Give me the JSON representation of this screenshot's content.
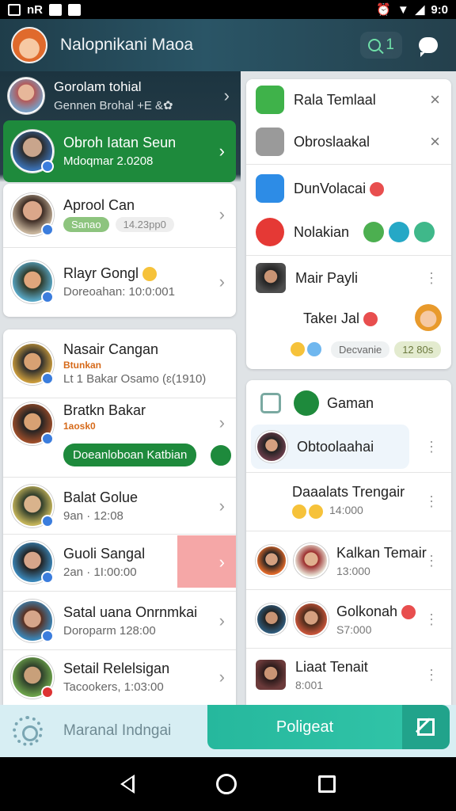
{
  "statusbar": {
    "left_text": "nR",
    "time": "9:0"
  },
  "header": {
    "title": "Nalopnikani Maoa",
    "search_count": "1"
  },
  "chats": [
    {
      "name": "Gorolam tohial",
      "sub": "Gennen Brohal +E &✿"
    },
    {
      "name": "Obroh Iatan Seun",
      "sub": "Mdoqmar 2.0208"
    },
    {
      "name": "Aprool Can",
      "pill": "Sanao",
      "sub": "14.23pp0"
    },
    {
      "name": "Rlayr Gongl",
      "sub": "Doreoahan: 10:0:001"
    },
    {
      "name": "Nasair Cangan",
      "tag": "Btunkan",
      "sub": "Lt 1 Bakar Osamo (ɛ(1910)"
    },
    {
      "name": "Bratkn Bakar",
      "tag": "1aosk0",
      "bar": "Doeanloboan Katbian"
    },
    {
      "name": "Balat Golue",
      "sub": "9an · 12:08"
    },
    {
      "name": "Guoli Sangal",
      "sub": "2an · 1I:00:00"
    },
    {
      "name": "Satal uana Onrnmkai",
      "sub": "Doroparm 128:00"
    },
    {
      "name": "Setail Relelsigan",
      "sub": "Tacookers, 1:03:00"
    }
  ],
  "panel1": {
    "items": [
      {
        "label": "Rala Temlaal"
      },
      {
        "label": "Obroslaakal"
      },
      {
        "label": "DunVolacai"
      },
      {
        "label": "Nolakian"
      },
      {
        "label": "Mair Payli"
      },
      {
        "label": "Takeı Jal"
      }
    ],
    "chip_grey": "Decvanie",
    "chip_lime": "12 80s"
  },
  "panel2": {
    "header": "Gaman",
    "items": [
      {
        "label": "Obtoolaahai"
      },
      {
        "label": "Daaalats Trengair",
        "sub": "14:000"
      },
      {
        "label": "Kalkan Temair",
        "sub": "13:000"
      },
      {
        "label": "Golkonah",
        "sub": "S7:000"
      },
      {
        "label": "Liaat Tenait",
        "sub": "8:001"
      }
    ]
  },
  "bottombar": {
    "label": "Maranal Indngai",
    "button": "Poligeat"
  },
  "colors": {
    "accent": "#1e8a3c",
    "teal": "#26b89d",
    "appbar": "#24404c"
  },
  "icons": [
    "settings-gear-icon",
    "compose-icon",
    "chat-bubble-icon",
    "search-icon"
  ]
}
